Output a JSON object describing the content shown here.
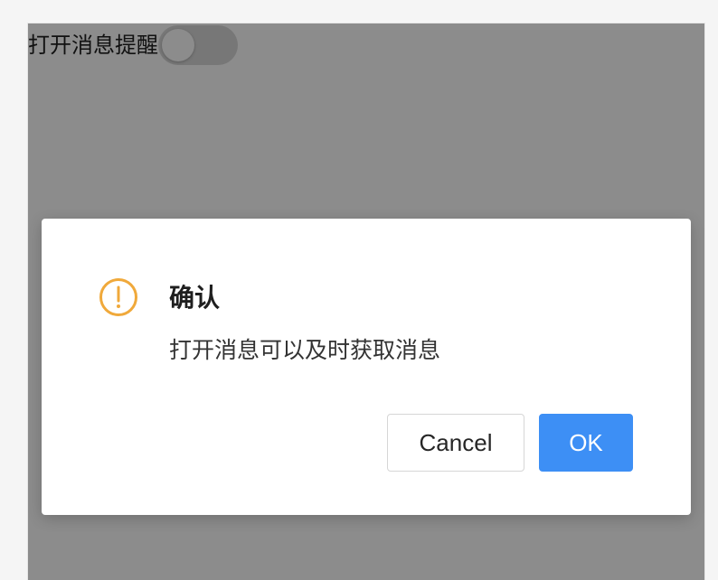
{
  "setting": {
    "label": "打开消息提醒",
    "toggle_on": false
  },
  "dialog": {
    "icon": "warning-circle-icon",
    "title": "确认",
    "content": "打开消息可以及时获取消息",
    "cancel_label": "Cancel",
    "ok_label": "OK"
  },
  "colors": {
    "warning": "#f0a93b",
    "primary": "#3d8ff5",
    "mask": "rgba(0,0,0,0.45)"
  }
}
